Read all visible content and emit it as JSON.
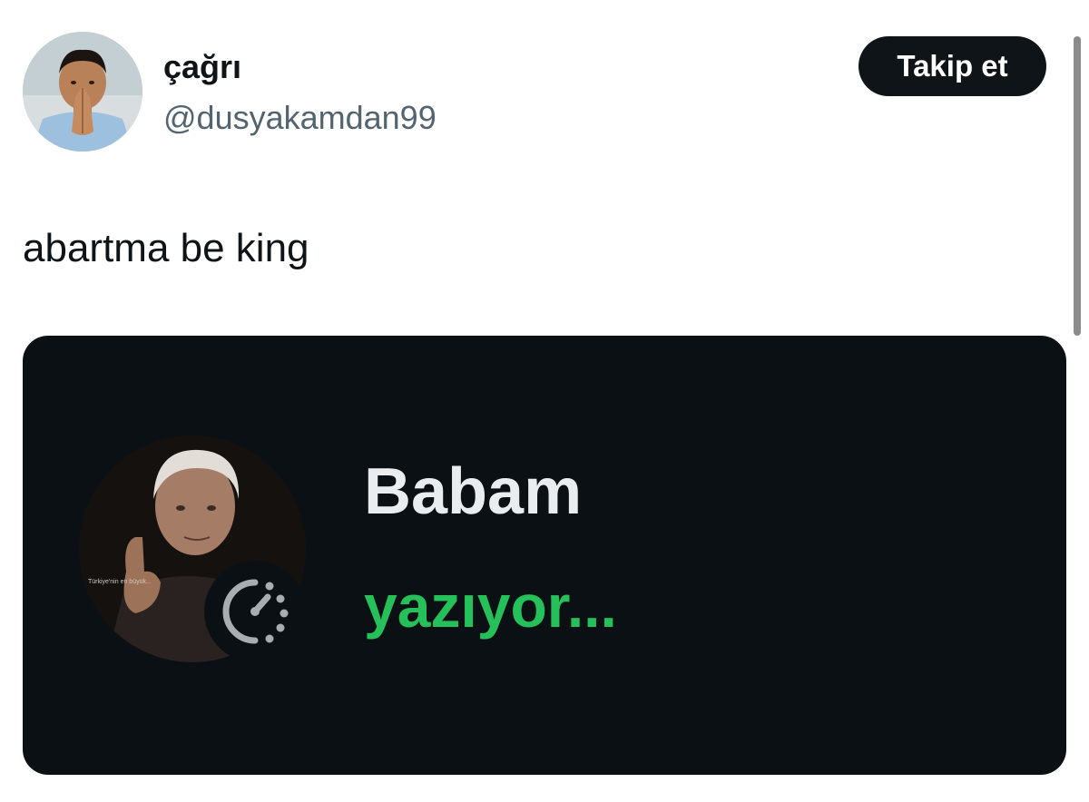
{
  "author": {
    "display_name": "çağrı",
    "handle": "@dusyakamdan99",
    "avatar_icon": "profile-photo"
  },
  "follow_button": {
    "label": "Takip et"
  },
  "tweet": {
    "text": "abartma be king"
  },
  "media": {
    "contact_name": "Babam",
    "status": "yazıyor...",
    "status_color": "#25c05a",
    "background_color": "#0b1014",
    "avatar_icon": "contact-photo",
    "badge_icon": "disappearing-timer-icon",
    "avatar_caption": "Türkiye'nin en büyük..."
  },
  "colors": {
    "button_bg": "#0f1419",
    "text_primary": "#0f1419",
    "text_secondary": "#536471"
  }
}
